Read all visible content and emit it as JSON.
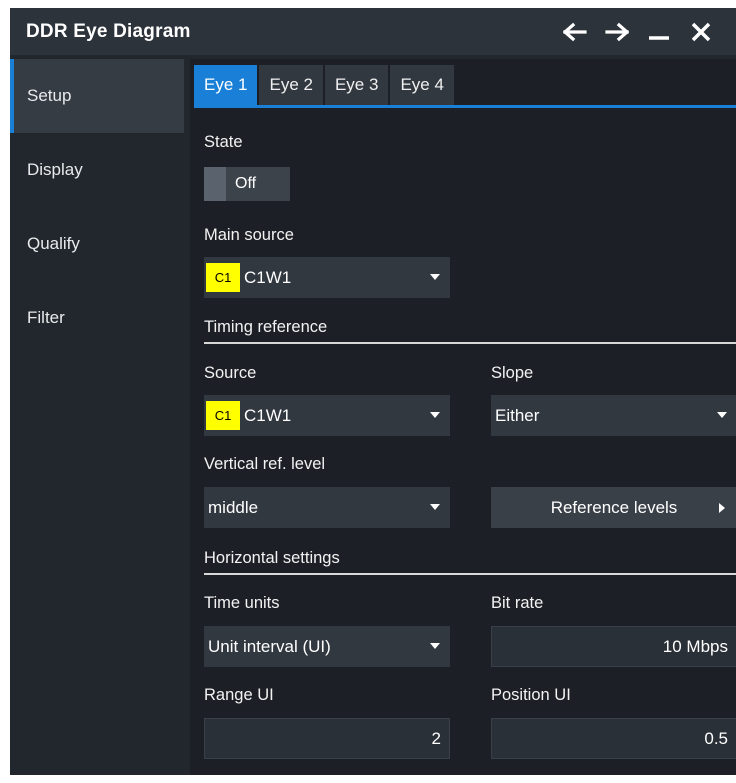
{
  "window": {
    "title": "DDR Eye Diagram"
  },
  "titlebar_icons": [
    "arrow-left-icon",
    "arrow-right-icon",
    "minimize-icon",
    "close-icon"
  ],
  "sidebar": {
    "items": [
      {
        "label": "Setup",
        "active": true
      },
      {
        "label": "Display",
        "active": false
      },
      {
        "label": "Qualify",
        "active": false
      },
      {
        "label": "Filter",
        "active": false
      }
    ]
  },
  "tabs": [
    {
      "label": "Eye 1",
      "active": true
    },
    {
      "label": "Eye 2",
      "active": false
    },
    {
      "label": "Eye 3",
      "active": false
    },
    {
      "label": "Eye 4",
      "active": false
    }
  ],
  "state": {
    "label": "State",
    "value": "Off"
  },
  "main_source": {
    "label": "Main source",
    "chip": "C1",
    "value": "C1W1"
  },
  "timing_reference": {
    "title": "Timing reference",
    "source": {
      "label": "Source",
      "chip": "C1",
      "value": "C1W1"
    },
    "slope": {
      "label": "Slope",
      "value": "Either"
    },
    "vertical_ref_level": {
      "label": "Vertical ref. level",
      "value": "middle"
    },
    "reference_levels_button": "Reference levels"
  },
  "horizontal_settings": {
    "title": "Horizontal settings",
    "time_units": {
      "label": "Time units",
      "value": "Unit interval (UI)"
    },
    "bit_rate": {
      "label": "Bit rate",
      "value": "10 Mbps"
    },
    "range_ui": {
      "label": "Range UI",
      "value": "2"
    },
    "position_ui": {
      "label": "Position UI",
      "value": "0.5"
    }
  },
  "colors": {
    "accent": "#1a7fd6",
    "chip": "#ffff00",
    "background": "#22272d"
  }
}
